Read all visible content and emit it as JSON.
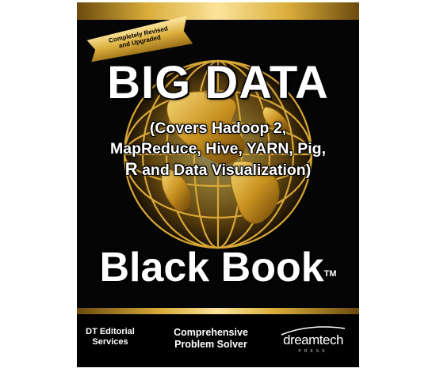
{
  "cover": {
    "ribbon_line1": "Completely Revised",
    "ribbon_line2": "and Upgraded",
    "title": "BIG DATA",
    "subtitle_line1": "(Covers Hadoop 2,",
    "subtitle_line2": "MapReduce, Hive, YARN, Pig,",
    "subtitle_line3_first": "R",
    "subtitle_line3_rest": " and Data Visualization)",
    "series_title": "Black Book",
    "trademark": "TM",
    "author_line1": "DT Editorial",
    "author_line2": "Services",
    "tagline_line1": "Comprehensive",
    "tagline_line2": "Problem Solver",
    "publisher_name": "dreamtech",
    "publisher_sub": "PRESS"
  },
  "colors": {
    "gold": "#d9ad3a",
    "gold_light": "#fbe39a",
    "background": "#050505",
    "text": "#ffffff"
  },
  "icons": {
    "globe": "globe-icon",
    "ribbon": "ribbon-banner-icon",
    "publisher_logo": "dreamtech-logo-icon"
  }
}
